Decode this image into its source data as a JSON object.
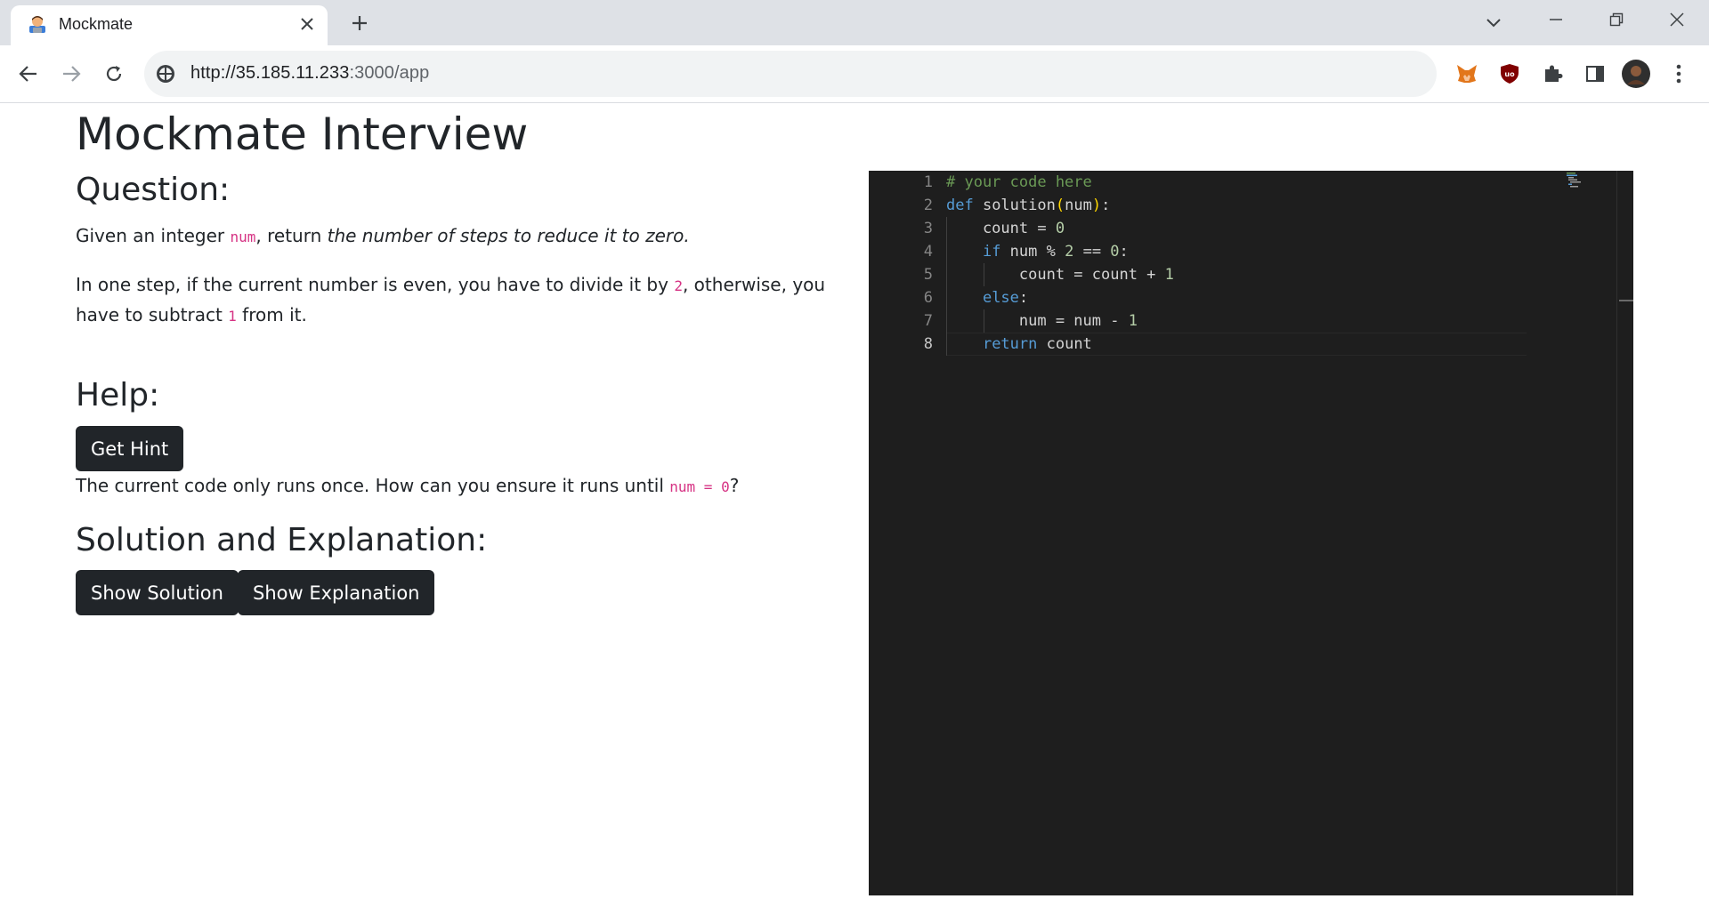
{
  "browser": {
    "tab_title": "Mockmate",
    "url_host": "http://35.185.11.233",
    "url_rest": ":3000/app"
  },
  "page": {
    "title": "Mockmate Interview",
    "question_heading": "Question:",
    "question_p1": {
      "pre": "Given an integer ",
      "code": "num",
      "mid": ", return ",
      "em": "the number of steps to reduce it to zero."
    },
    "question_p2": {
      "pre": "In one step, if the current number is even, you have to divide it by ",
      "code1": "2",
      "mid": ", otherwise, you have to subtract ",
      "code2": "1",
      "post": " from it."
    },
    "help_heading": "Help:",
    "hint_button": "Get Hint",
    "hint_text": {
      "pre": "The current code only runs once. How can you ensure it runs until ",
      "code": "num = 0",
      "post": "?"
    },
    "solution_heading": "Solution and Explanation:",
    "show_solution_button": "Show Solution",
    "show_explanation_button": "Show Explanation"
  },
  "editor": {
    "active_line": 8,
    "lines": [
      "# your code here",
      "def solution(num):",
      "    count = 0",
      "    if num % 2 == 0:",
      "        count = count + 1",
      "    else:",
      "        num = num - 1",
      "    return count"
    ]
  },
  "colors": {
    "button_bg": "#212529",
    "code_pink": "#d63384",
    "editor_bg": "#1e1e1e"
  }
}
